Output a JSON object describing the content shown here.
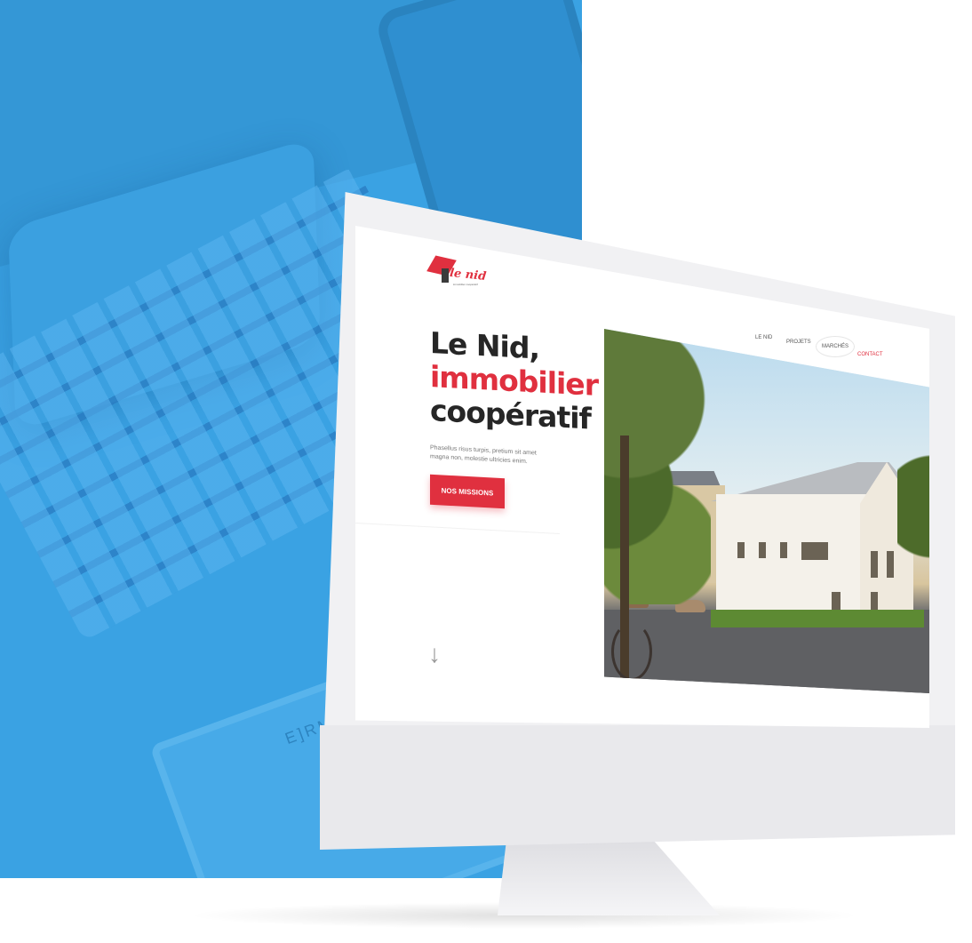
{
  "background": {
    "panel_color": "#3aa2e3",
    "laptop_text": "E]RM"
  },
  "site": {
    "logo": {
      "brand": "le nid",
      "tagline": "immobilier coopératif"
    },
    "nav": [
      {
        "label": "LE NID"
      },
      {
        "label": "PROJETS"
      },
      {
        "label": "MARCHÉS"
      },
      {
        "label": "CONTACT"
      }
    ],
    "hero": {
      "title_line1": "Le Nid,",
      "title_line2": "immobilier",
      "title_line3": "coopératif",
      "text": "Phasellus risus turpis, pretium sit amet magna non, molestie ultricies enim.",
      "cta_label": "NOS MISSIONS",
      "scroll_icon": "↓"
    },
    "colors": {
      "accent": "#e0303f",
      "text": "#262626"
    }
  },
  "device": {
    "apple_logo": ""
  }
}
